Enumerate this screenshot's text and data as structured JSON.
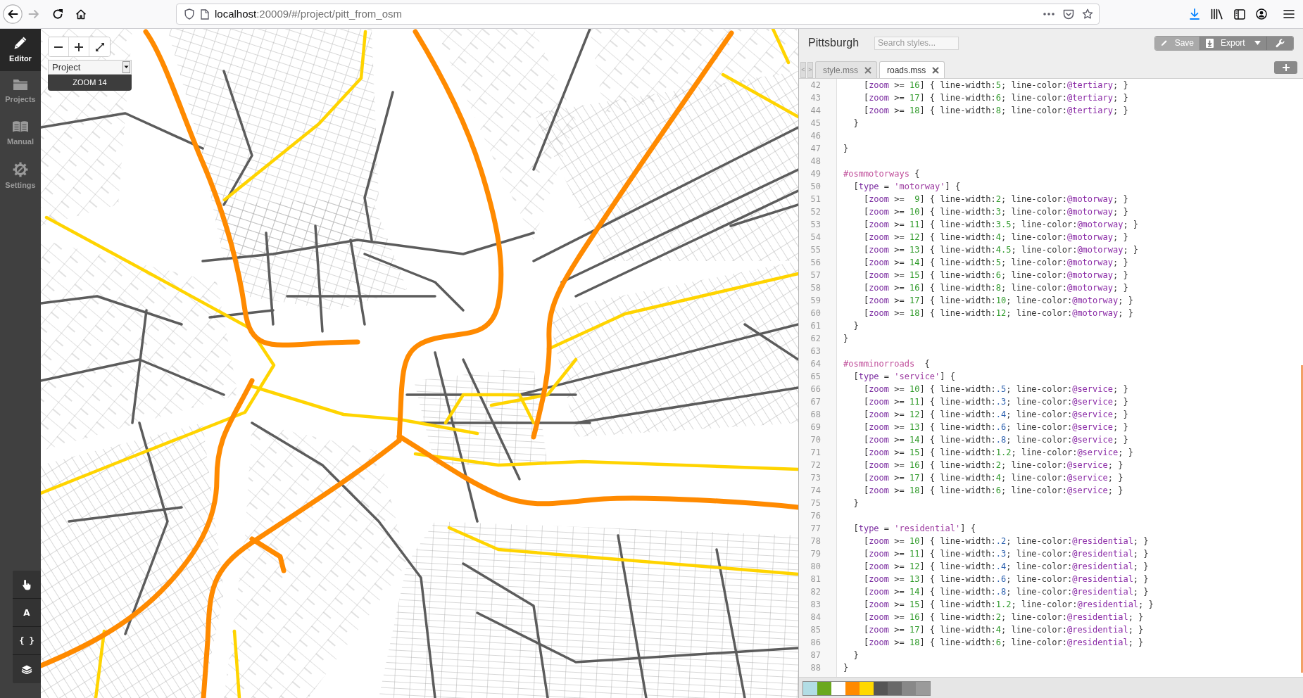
{
  "browser": {
    "nav_buttons": [
      {
        "kind": "back",
        "disabled": false
      },
      {
        "kind": "forward",
        "disabled": true
      },
      {
        "kind": "reload",
        "disabled": false
      },
      {
        "kind": "home",
        "disabled": false
      }
    ],
    "url": {
      "host": "localhost",
      "rest": ":20009/#/project/pitt_from_osm"
    }
  },
  "sidebar": {
    "items": [
      {
        "kind": "editor",
        "label": "Editor",
        "selected": true
      },
      {
        "kind": "projects",
        "label": "Projects",
        "selected": false
      },
      {
        "kind": "manual",
        "label": "Manual",
        "selected": false
      },
      {
        "kind": "settings",
        "label": "Settings",
        "selected": false
      }
    ],
    "tools": [
      {
        "kind": "hand"
      },
      {
        "kind": "fonts",
        "label": "A"
      },
      {
        "kind": "reference",
        "label": "{ }"
      },
      {
        "kind": "layers"
      }
    ]
  },
  "map": {
    "layer_select": "Project",
    "zoom_label": "ZOOM 14"
  },
  "editor": {
    "title": "Pittsburgh",
    "search": {
      "placeholder": "Search styles..."
    },
    "buttons": [
      {
        "kind": "save",
        "label": "Save",
        "disabled": true
      },
      {
        "kind": "export",
        "label": "Export",
        "disabled": false
      },
      {
        "kind": "tools",
        "disabled": false
      }
    ],
    "tab_scroll": [
      "<",
      ">"
    ],
    "tabs": [
      {
        "label": "style.mss",
        "selected": false
      },
      {
        "label": "roads.mss",
        "selected": true
      }
    ],
    "lines": [
      {
        "n": "42",
        "code": "    [zoom >= 16] { line-width:5; line-color:@tertiary; }"
      },
      {
        "n": "43",
        "code": "    [zoom >= 17] { line-width:6; line-color:@tertiary; }"
      },
      {
        "n": "44",
        "code": "    [zoom >= 18] { line-width:8; line-color:@tertiary; }"
      },
      {
        "n": "45",
        "code": "  }"
      },
      {
        "n": "46"
      },
      {
        "n": "47",
        "code": "}"
      },
      {
        "n": "48"
      },
      {
        "n": "49",
        "code": "#osmmotorways {"
      },
      {
        "n": "50",
        "code": "  [type = 'motorway'] {"
      },
      {
        "n": "51",
        "code": "    [zoom >=  9] { line-width:2; line-color:@motorway; }"
      },
      {
        "n": "52",
        "code": "    [zoom >= 10] { line-width:3; line-color:@motorway; }"
      },
      {
        "n": "53",
        "code": "    [zoom >= 11] { line-width:3.5; line-color:@motorway; }"
      },
      {
        "n": "54",
        "code": "    [zoom >= 12] { line-width:4; line-color:@motorway; }"
      },
      {
        "n": "55",
        "code": "    [zoom >= 13] { line-width:4.5; line-color:@motorway; }"
      },
      {
        "n": "56",
        "code": "    [zoom >= 14] { line-width:5; line-color:@motorway; }"
      },
      {
        "n": "57",
        "code": "    [zoom >= 15] { line-width:6; line-color:@motorway; }"
      },
      {
        "n": "58",
        "code": "    [zoom >= 16] { line-width:8; line-color:@motorway; }"
      },
      {
        "n": "59",
        "code": "    [zoom >= 17] { line-width:10; line-color:@motorway; }"
      },
      {
        "n": "60",
        "code": "    [zoom >= 18] { line-width:12; line-color:@motorway; }"
      },
      {
        "n": "61",
        "code": "  }"
      },
      {
        "n": "62",
        "code": "}"
      },
      {
        "n": "63"
      },
      {
        "n": "64",
        "code": "#osmminorroads  {"
      },
      {
        "n": "65",
        "code": "  [type = 'service'] {"
      },
      {
        "n": "66",
        "code": "    [zoom >= 10] { line-width:.5; line-color:@service; }"
      },
      {
        "n": "67",
        "code": "    [zoom >= 11] { line-width:.3; line-color:@service; }"
      },
      {
        "n": "68",
        "code": "    [zoom >= 12] { line-width:.4; line-color:@service; }"
      },
      {
        "n": "69",
        "code": "    [zoom >= 13] { line-width:.6; line-color:@service; }"
      },
      {
        "n": "70",
        "code": "    [zoom >= 14] { line-width:.8; line-color:@service; }"
      },
      {
        "n": "71",
        "code": "    [zoom >= 15] { line-width:1.2; line-color:@service; }"
      },
      {
        "n": "72",
        "code": "    [zoom >= 16] { line-width:2; line-color:@service; }"
      },
      {
        "n": "73",
        "code": "    [zoom >= 17] { line-width:4; line-color:@service; }"
      },
      {
        "n": "74",
        "code": "    [zoom >= 18] { line-width:6; line-color:@service; }"
      },
      {
        "n": "75",
        "code": "  }"
      },
      {
        "n": "76"
      },
      {
        "n": "77",
        "code": "  [type = 'residential'] {"
      },
      {
        "n": "78",
        "code": "    [zoom >= 10] { line-width:.2; line-color:@residential; }"
      },
      {
        "n": "79",
        "code": "    [zoom >= 11] { line-width:.3; line-color:@residential; }"
      },
      {
        "n": "80",
        "code": "    [zoom >= 12] { line-width:.4; line-color:@residential; }"
      },
      {
        "n": "81",
        "code": "    [zoom >= 13] { line-width:.6; line-color:@residential; }"
      },
      {
        "n": "82",
        "code": "    [zoom >= 14] { line-width:.8; line-color:@residential; }"
      },
      {
        "n": "83",
        "code": "    [zoom >= 15] { line-width:1.2; line-color:@residential; }"
      },
      {
        "n": "84",
        "code": "    [zoom >= 16] { line-width:2; line-color:@residential; }"
      },
      {
        "n": "85",
        "code": "    [zoom >= 17] { line-width:4; line-color:@residential; }"
      },
      {
        "n": "86",
        "code": "    [zoom >= 18] { line-width:6; line-color:@residential; }"
      },
      {
        "n": "87",
        "code": "  }"
      },
      {
        "n": "88",
        "code": "}"
      }
    ],
    "swatches": [
      {
        "color": "#b2dde5"
      },
      {
        "color": "#6ba81e"
      },
      {
        "color": "#ffffff"
      },
      {
        "color": "#ff8a00"
      },
      {
        "color": "#ffd800"
      },
      {
        "color": "#555555"
      },
      {
        "color": "#696969"
      },
      {
        "color": "#888888"
      },
      {
        "color": "#9a9a9a"
      }
    ]
  }
}
